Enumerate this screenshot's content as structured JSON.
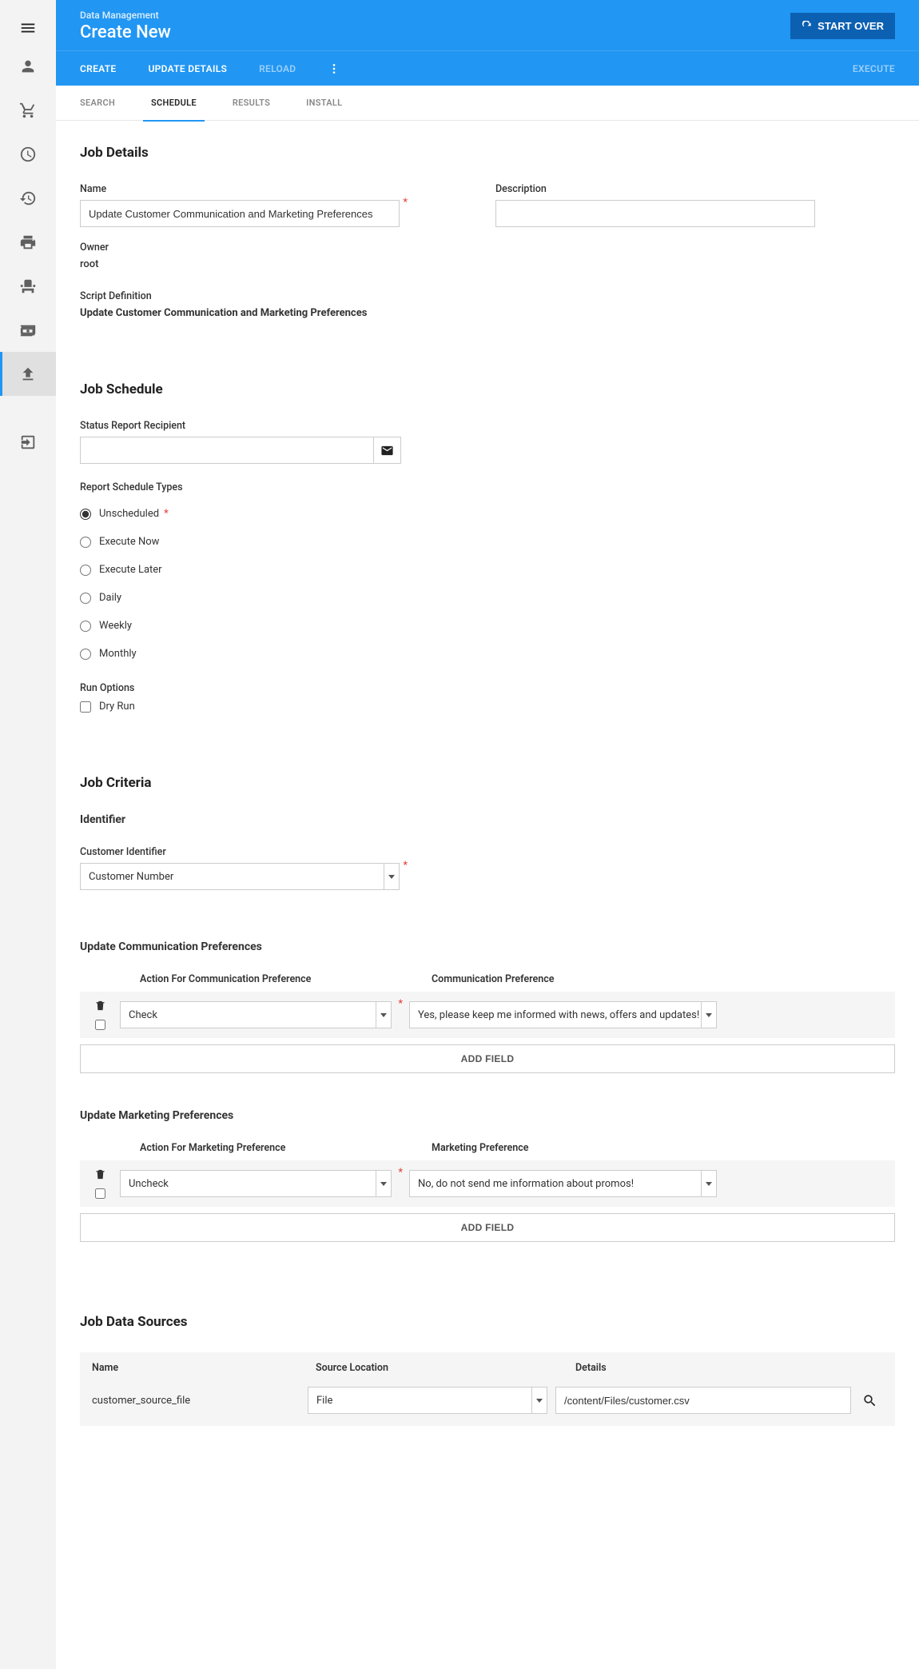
{
  "header": {
    "breadcrumb": "Data Management",
    "title": "Create New",
    "start_over": "START OVER"
  },
  "action_bar": {
    "create": "CREATE",
    "update_details": "UPDATE DETAILS",
    "reload": "RELOAD",
    "execute": "EXECUTE"
  },
  "sub_tabs": {
    "search": "SEARCH",
    "schedule": "SCHEDULE",
    "results": "RESULTS",
    "install": "INSTALL"
  },
  "sections": {
    "job_details": "Job Details",
    "job_schedule": "Job Schedule",
    "job_criteria": "Job Criteria",
    "job_data_sources": "Job Data Sources"
  },
  "job_details": {
    "name_label": "Name",
    "name_value": "Update Customer Communication and Marketing Preferences",
    "description_label": "Description",
    "description_value": "",
    "owner_label": "Owner",
    "owner_value": "root",
    "script_def_label": "Script Definition",
    "script_def_value": "Update Customer Communication and Marketing Preferences"
  },
  "job_schedule": {
    "recipient_label": "Status Report Recipient",
    "recipient_value": "",
    "types_label": "Report Schedule Types",
    "options": {
      "unscheduled": "Unscheduled",
      "execute_now": "Execute Now",
      "execute_later": "Execute Later",
      "daily": "Daily",
      "weekly": "Weekly",
      "monthly": "Monthly"
    },
    "run_options_label": "Run Options",
    "dry_run": "Dry Run"
  },
  "job_criteria": {
    "identifier_heading": "Identifier",
    "customer_id_label": "Customer Identifier",
    "customer_id_value": "Customer Number",
    "ucp_heading": "Update Communication Preferences",
    "ucp_col1": "Action For Communication Preference",
    "ucp_col2": "Communication Preference",
    "ucp_action": "Check",
    "ucp_pref": "Yes, please keep me informed with news, offers and updates!",
    "ump_heading": "Update Marketing Preferences",
    "ump_col1": "Action For Marketing Preference",
    "ump_col2": "Marketing Preference",
    "ump_action": "Uncheck",
    "ump_pref": "No, do not send me information about promos!",
    "add_field": "ADD FIELD"
  },
  "data_sources": {
    "name_col": "Name",
    "location_col": "Source Location",
    "details_col": "Details",
    "row_name": "customer_source_file",
    "row_location": "File",
    "row_details": "/content/Files/customer.csv"
  }
}
